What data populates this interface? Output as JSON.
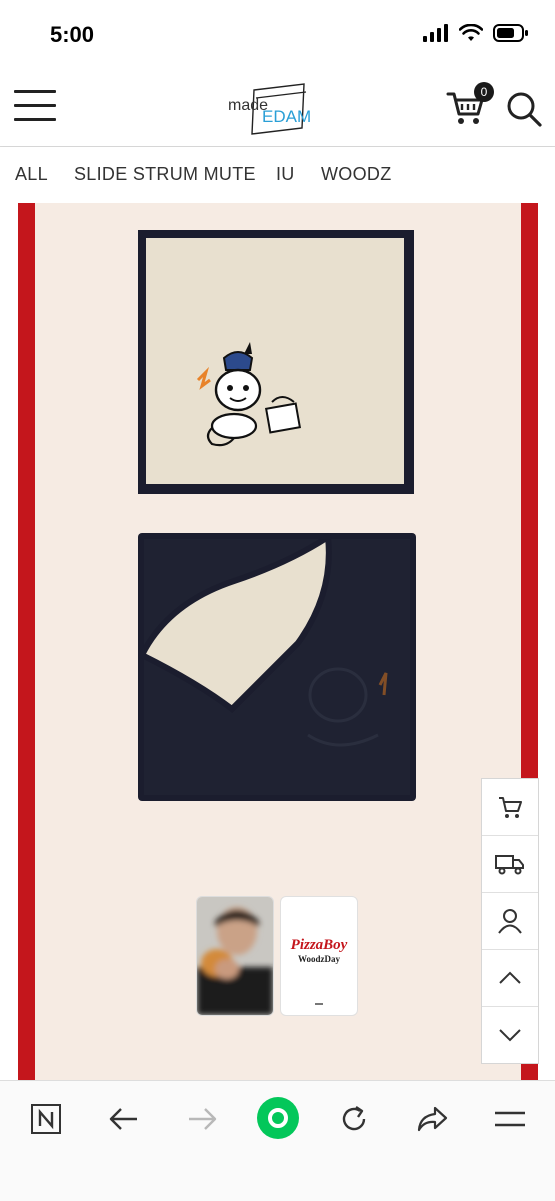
{
  "status_bar": {
    "time": "5:00"
  },
  "header": {
    "logo_made": "made",
    "logo_edam": "EDAM",
    "cart_count": "0"
  },
  "category_nav": [
    "ALL",
    "SLIDE STRUM MUTE",
    "IU",
    "WOODZ"
  ],
  "thumbnails": {
    "pizza_boy_title": "PizzaBoy",
    "pizza_boy_sub": "WoodzDay"
  },
  "side_tools": [
    "cart-icon",
    "delivery-truck-icon",
    "user-icon",
    "chevron-up-icon",
    "chevron-down-icon"
  ],
  "bottom_bar": [
    "naver-n-icon",
    "back-arrow-icon",
    "forward-arrow-icon",
    "green-home-dot-icon",
    "refresh-icon",
    "share-icon",
    "menu-icon"
  ],
  "colors": {
    "frame_red": "#c4161c",
    "frame_bg": "#f6ebe3",
    "naver_green": "#03c75a",
    "towel_navy": "#1b1d2e",
    "towel_cream": "#e8e0cf"
  }
}
